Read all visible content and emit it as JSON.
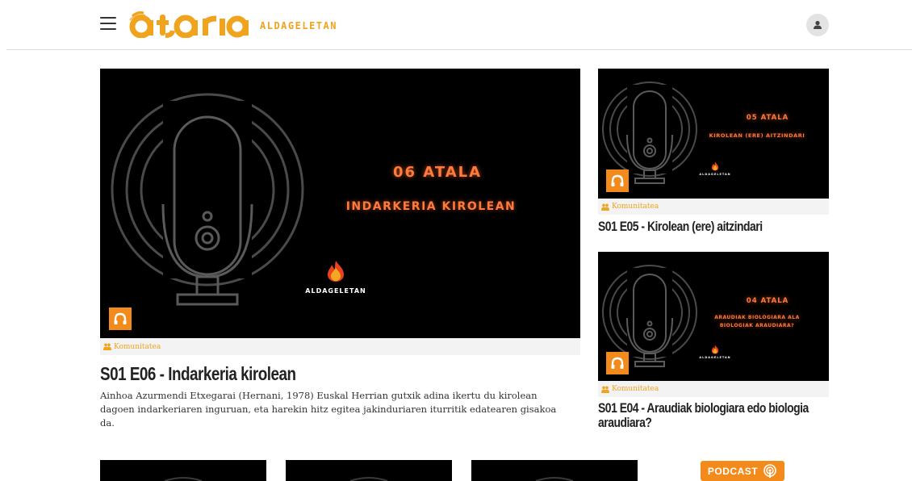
{
  "header": {
    "logo_text": "ataria",
    "logo_subtitle": "ALDAGELETAN",
    "menu_icon": "hamburger-icon",
    "user_icon": "user-icon",
    "accent_color": "#f0a31c"
  },
  "featured": {
    "thumb_episode": "06 ATALA",
    "thumb_topic": "INDARKERIA KIROLEAN",
    "thumb_brand": "ALDAGELETAN",
    "category": "Komunitatea",
    "title": "S01 E06 - Indarkeria kirolean",
    "description": "Ainhoa Azurmendi Etxegarai (Hernani, 1978) Euskal Herrian gutxik adina ikertu du kirolean dagoen indarkeriaren inguruan, eta harekin hitz egitea jakinduriaren iturritik edatearen gisakoa da."
  },
  "side_cards": [
    {
      "thumb_episode": "05 ATALA",
      "thumb_topic": "KIROLEAN (ERE) AITZINDARI",
      "thumb_brand": "ALDAGELETAN",
      "category": "Komunitatea",
      "title": "S01 E05 - Kirolean (ere) aitzindari"
    },
    {
      "thumb_episode": "04 ATALA",
      "thumb_topic_line1": "ARAUDIAK BIOLOGIARA ALA",
      "thumb_topic_line2": "BIOLOGIAK ARAUDIARA?",
      "thumb_brand": "ALDAGELETAN",
      "category": "Komunitatea",
      "title": "S01 E04 - Araudiak biologiara edo biologia araudiara?"
    }
  ],
  "podcast_button": {
    "label": "PODCAST",
    "icon": "podcast-icon"
  },
  "colors": {
    "accent_orange": "#f28a1c",
    "neon_text": "#ff7a3c",
    "category_bg": "#f3f3f3"
  }
}
